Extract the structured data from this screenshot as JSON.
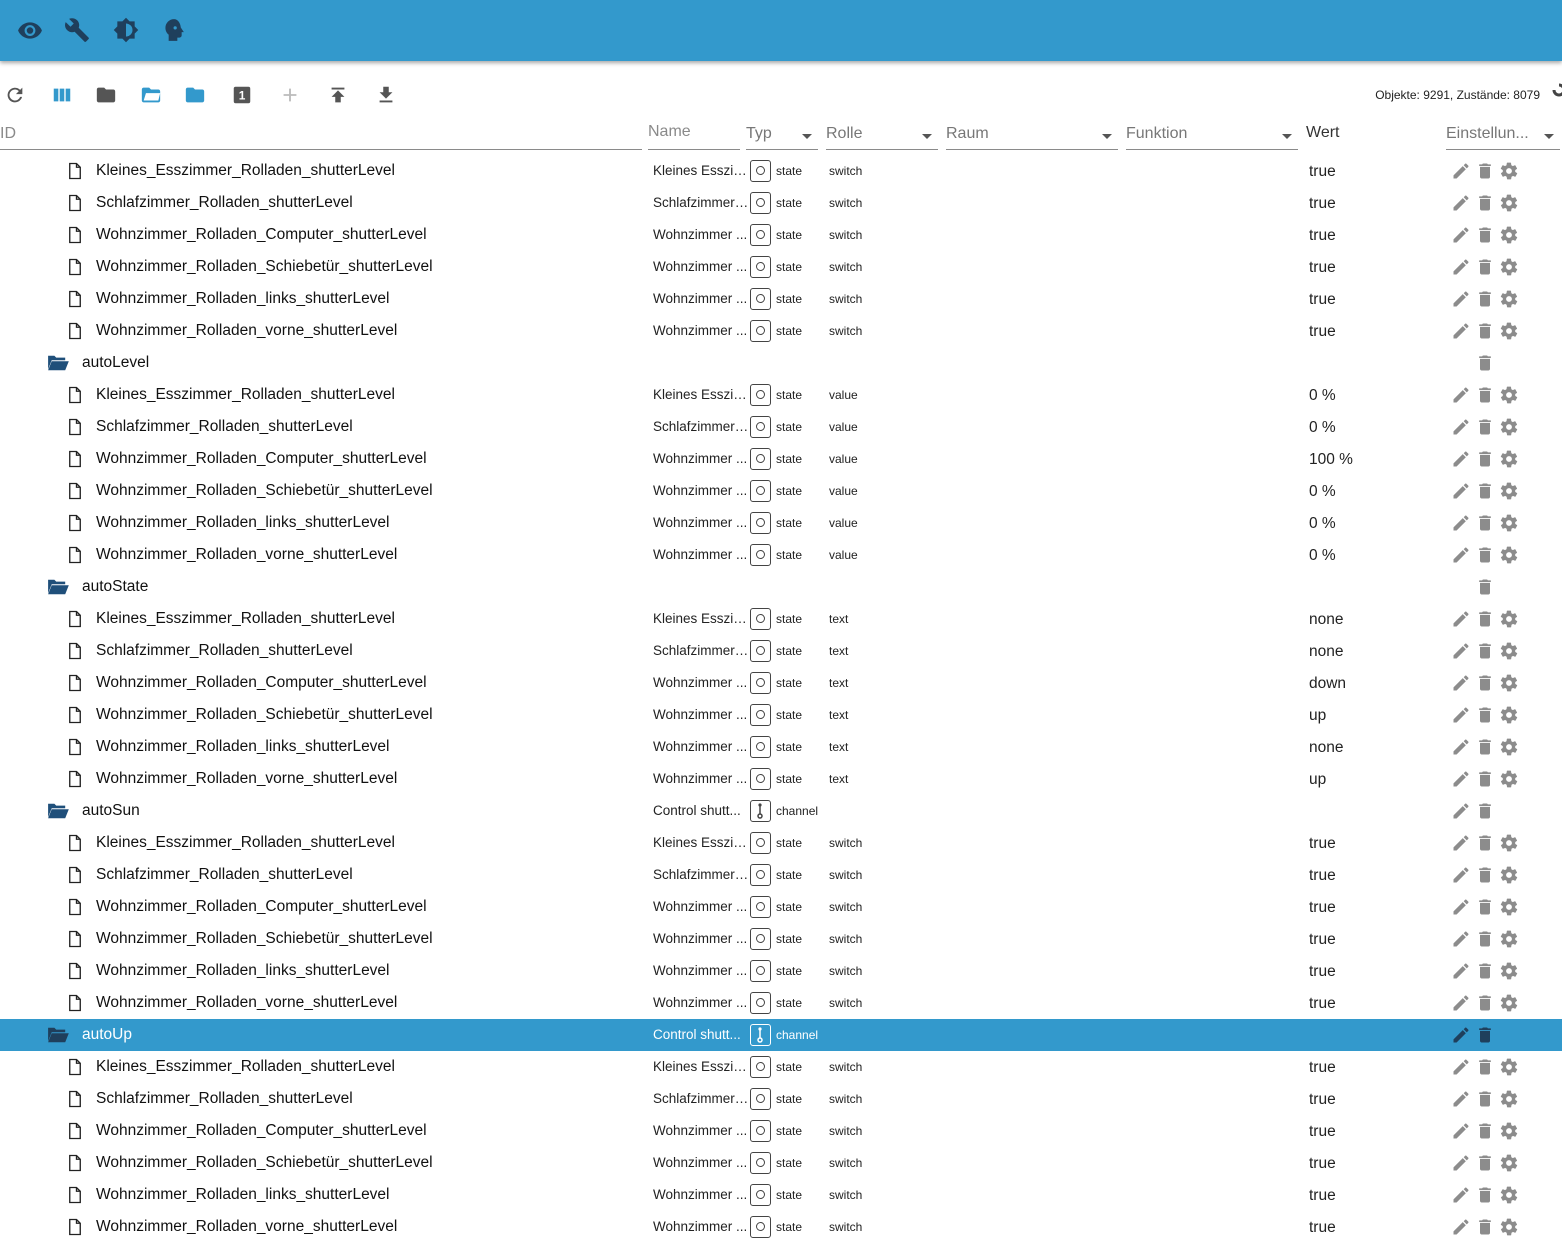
{
  "topbar": {
    "icons": [
      "eye-icon",
      "wrench-icon",
      "brightness-icon",
      "expert-mode-icon"
    ],
    "color": "#3399cc"
  },
  "toolbar": {
    "icons": [
      "refresh-icon",
      "columns-icon",
      "folder-collapse-icon",
      "folder-open-icon",
      "folder-expand-icon",
      "level-1-icon",
      "add-icon",
      "upload-icon",
      "download-icon"
    ],
    "level_label": "1",
    "counts": "Objekte: 9291, Zustände: 8079"
  },
  "columns": {
    "id": "ID",
    "name": "Name",
    "typ": "Typ",
    "rolle": "Rolle",
    "raum": "Raum",
    "funktion": "Funktion",
    "wert": "Wert",
    "einstellungen": "Einstellun..."
  },
  "rows": [
    {
      "kind": "state",
      "id": "Kleines_Esszimmer_Rolladen_shutterLevel",
      "name": "Kleines Esszim...",
      "type": "state",
      "role": "switch",
      "value": "true"
    },
    {
      "kind": "state",
      "id": "Schlafzimmer_Rolladen_shutterLevel",
      "name": "Schlafzimmer ...",
      "type": "state",
      "role": "switch",
      "value": "true"
    },
    {
      "kind": "state",
      "id": "Wohnzimmer_Rolladen_Computer_shutterLevel",
      "name": "Wohnzimmer ...",
      "type": "state",
      "role": "switch",
      "value": "true"
    },
    {
      "kind": "state",
      "id": "Wohnzimmer_Rolladen_Schiebetür_shutterLevel",
      "name": "Wohnzimmer ...",
      "type": "state",
      "role": "switch",
      "value": "true"
    },
    {
      "kind": "state",
      "id": "Wohnzimmer_Rolladen_links_shutterLevel",
      "name": "Wohnzimmer ...",
      "type": "state",
      "role": "switch",
      "value": "true"
    },
    {
      "kind": "state",
      "id": "Wohnzimmer_Rolladen_vorne_shutterLevel",
      "name": "Wohnzimmer ...",
      "type": "state",
      "role": "switch",
      "value": "true"
    },
    {
      "kind": "folder",
      "id": "autoLevel",
      "name": "",
      "type": "",
      "role": "",
      "value": ""
    },
    {
      "kind": "state",
      "id": "Kleines_Esszimmer_Rolladen_shutterLevel",
      "name": "Kleines Esszim...",
      "type": "state",
      "role": "value",
      "value": "0 %"
    },
    {
      "kind": "state",
      "id": "Schlafzimmer_Rolladen_shutterLevel",
      "name": "Schlafzimmer ...",
      "type": "state",
      "role": "value",
      "value": "0 %"
    },
    {
      "kind": "state",
      "id": "Wohnzimmer_Rolladen_Computer_shutterLevel",
      "name": "Wohnzimmer ...",
      "type": "state",
      "role": "value",
      "value": "100 %"
    },
    {
      "kind": "state",
      "id": "Wohnzimmer_Rolladen_Schiebetür_shutterLevel",
      "name": "Wohnzimmer ...",
      "type": "state",
      "role": "value",
      "value": "0 %"
    },
    {
      "kind": "state",
      "id": "Wohnzimmer_Rolladen_links_shutterLevel",
      "name": "Wohnzimmer ...",
      "type": "state",
      "role": "value",
      "value": "0 %"
    },
    {
      "kind": "state",
      "id": "Wohnzimmer_Rolladen_vorne_shutterLevel",
      "name": "Wohnzimmer ...",
      "type": "state",
      "role": "value",
      "value": "0 %"
    },
    {
      "kind": "folder",
      "id": "autoState",
      "name": "",
      "type": "",
      "role": "",
      "value": ""
    },
    {
      "kind": "state",
      "id": "Kleines_Esszimmer_Rolladen_shutterLevel",
      "name": "Kleines Esszim...",
      "type": "state",
      "role": "text",
      "value": "none"
    },
    {
      "kind": "state",
      "id": "Schlafzimmer_Rolladen_shutterLevel",
      "name": "Schlafzimmer ...",
      "type": "state",
      "role": "text",
      "value": "none"
    },
    {
      "kind": "state",
      "id": "Wohnzimmer_Rolladen_Computer_shutterLevel",
      "name": "Wohnzimmer ...",
      "type": "state",
      "role": "text",
      "value": "down"
    },
    {
      "kind": "state",
      "id": "Wohnzimmer_Rolladen_Schiebetür_shutterLevel",
      "name": "Wohnzimmer ...",
      "type": "state",
      "role": "text",
      "value": "up"
    },
    {
      "kind": "state",
      "id": "Wohnzimmer_Rolladen_links_shutterLevel",
      "name": "Wohnzimmer ...",
      "type": "state",
      "role": "text",
      "value": "none"
    },
    {
      "kind": "state",
      "id": "Wohnzimmer_Rolladen_vorne_shutterLevel",
      "name": "Wohnzimmer ...",
      "type": "state",
      "role": "text",
      "value": "up"
    },
    {
      "kind": "channel",
      "id": "autoSun",
      "name": "Control shutt...",
      "type": "channel",
      "role": "",
      "value": ""
    },
    {
      "kind": "state",
      "id": "Kleines_Esszimmer_Rolladen_shutterLevel",
      "name": "Kleines Esszim...",
      "type": "state",
      "role": "switch",
      "value": "true"
    },
    {
      "kind": "state",
      "id": "Schlafzimmer_Rolladen_shutterLevel",
      "name": "Schlafzimmer ...",
      "type": "state",
      "role": "switch",
      "value": "true"
    },
    {
      "kind": "state",
      "id": "Wohnzimmer_Rolladen_Computer_shutterLevel",
      "name": "Wohnzimmer ...",
      "type": "state",
      "role": "switch",
      "value": "true"
    },
    {
      "kind": "state",
      "id": "Wohnzimmer_Rolladen_Schiebetür_shutterLevel",
      "name": "Wohnzimmer ...",
      "type": "state",
      "role": "switch",
      "value": "true"
    },
    {
      "kind": "state",
      "id": "Wohnzimmer_Rolladen_links_shutterLevel",
      "name": "Wohnzimmer ...",
      "type": "state",
      "role": "switch",
      "value": "true"
    },
    {
      "kind": "state",
      "id": "Wohnzimmer_Rolladen_vorne_shutterLevel",
      "name": "Wohnzimmer ...",
      "type": "state",
      "role": "switch",
      "value": "true"
    },
    {
      "kind": "channel",
      "id": "autoUp",
      "name": "Control shutt...",
      "type": "channel",
      "role": "",
      "value": "",
      "selected": true
    },
    {
      "kind": "state",
      "id": "Kleines_Esszimmer_Rolladen_shutterLevel",
      "name": "Kleines Esszim...",
      "type": "state",
      "role": "switch",
      "value": "true"
    },
    {
      "kind": "state",
      "id": "Schlafzimmer_Rolladen_shutterLevel",
      "name": "Schlafzimmer ...",
      "type": "state",
      "role": "switch",
      "value": "true"
    },
    {
      "kind": "state",
      "id": "Wohnzimmer_Rolladen_Computer_shutterLevel",
      "name": "Wohnzimmer ...",
      "type": "state",
      "role": "switch",
      "value": "true"
    },
    {
      "kind": "state",
      "id": "Wohnzimmer_Rolladen_Schiebetür_shutterLevel",
      "name": "Wohnzimmer ...",
      "type": "state",
      "role": "switch",
      "value": "true"
    },
    {
      "kind": "state",
      "id": "Wohnzimmer_Rolladen_links_shutterLevel",
      "name": "Wohnzimmer ...",
      "type": "state",
      "role": "switch",
      "value": "true"
    },
    {
      "kind": "state",
      "id": "Wohnzimmer_Rolladen_vorne_shutterLevel",
      "name": "Wohnzimmer ...",
      "type": "state",
      "role": "switch",
      "value": "true"
    }
  ],
  "colors": {
    "accent": "#3399cc",
    "folder": "#1f4f7a",
    "action_icon": "#8c8c8c",
    "header_text": "#8a8a8a"
  }
}
